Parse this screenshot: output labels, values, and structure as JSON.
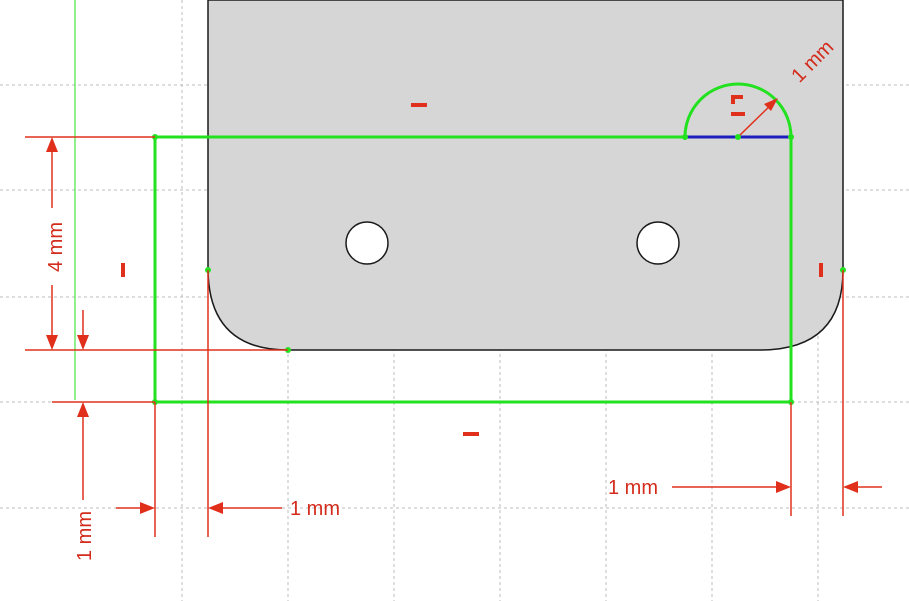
{
  "colors": {
    "background": "#ffffff",
    "grid": "#bdbdbd",
    "part_fill": "#d6d6d6",
    "part_stroke": "#1a1a1a",
    "profile": "#22e11e",
    "dimension": "#e0301c",
    "dimension_text": "#d42c1c",
    "axis": "#22e11e",
    "selected_edge": "#1e1ebe"
  },
  "dimensions": {
    "height": "4 mm",
    "arc_radius": "1 mm",
    "bottom_offset": "1 mm",
    "left_offset": "1 mm",
    "right_offset": "1 mm"
  }
}
